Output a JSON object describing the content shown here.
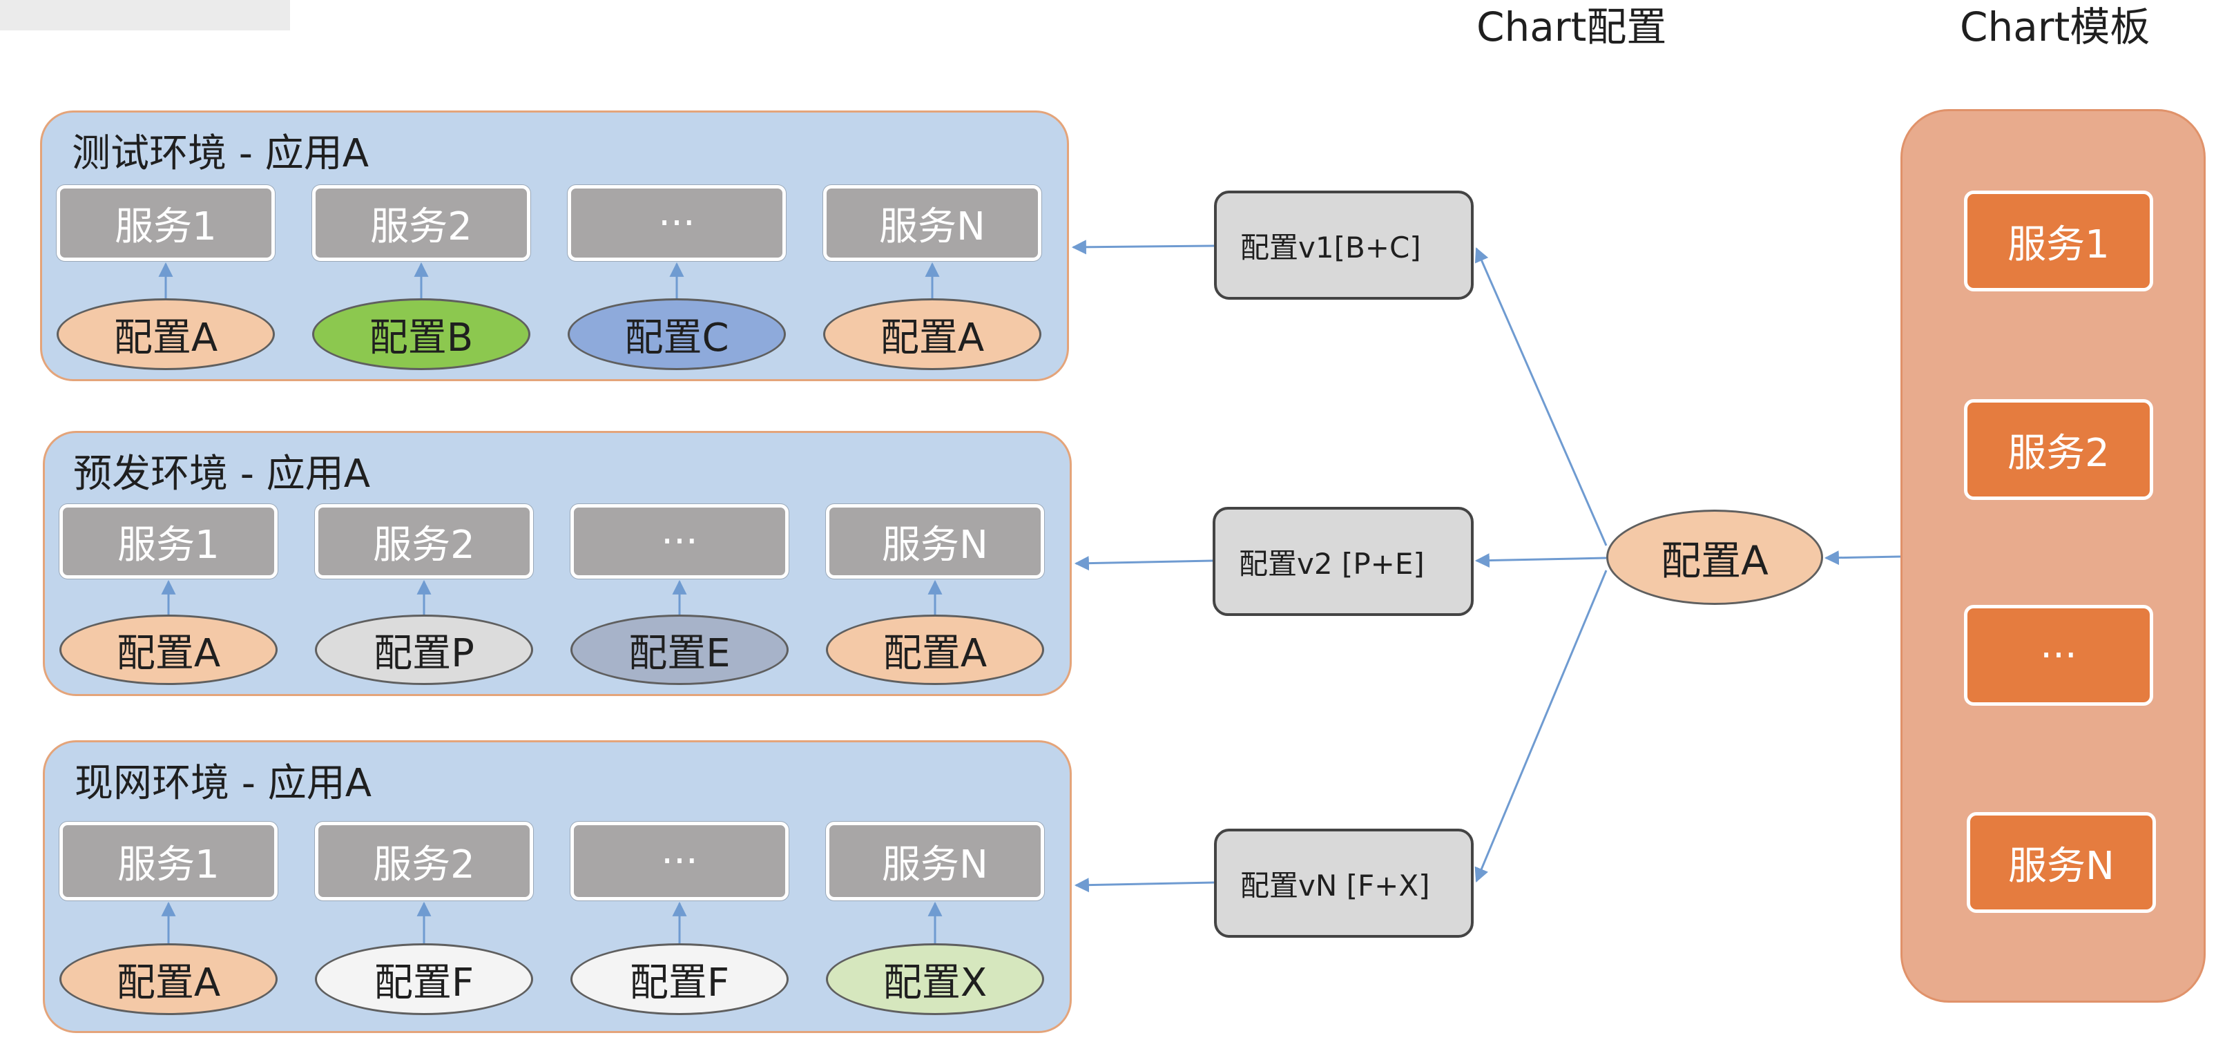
{
  "headers": {
    "chart_config": "Chart配置",
    "chart_template": "Chart模板"
  },
  "environments": [
    {
      "title": "测试环境 - 应用A",
      "services": [
        "服务1",
        "服务2",
        "···",
        "服务N"
      ],
      "configs": [
        {
          "label": "配置A",
          "color": "#f4c9a7"
        },
        {
          "label": "配置B",
          "color": "#8cc84f"
        },
        {
          "label": "配置C",
          "color": "#8eaadb"
        },
        {
          "label": "配置A",
          "color": "#f4c9a7"
        }
      ]
    },
    {
      "title": "预发环境 - 应用A",
      "services": [
        "服务1",
        "服务2",
        "···",
        "服务N"
      ],
      "configs": [
        {
          "label": "配置A",
          "color": "#f4c9a7"
        },
        {
          "label": "配置P",
          "color": "#dcdcdc"
        },
        {
          "label": "配置E",
          "color": "#a7b3c9"
        },
        {
          "label": "配置A",
          "color": "#f4c9a7"
        }
      ]
    },
    {
      "title": "现网环境 - 应用A",
      "services": [
        "服务1",
        "服务2",
        "···",
        "服务N"
      ],
      "configs": [
        {
          "label": "配置A",
          "color": "#f4c9a7"
        },
        {
          "label": "配置F",
          "color": "#f4f4f4"
        },
        {
          "label": "配置F",
          "color": "#f4f4f4"
        },
        {
          "label": "配置X",
          "color": "#d6e7be"
        }
      ]
    }
  ],
  "versions": [
    "配置v1[B+C]",
    "配置v2 [P+E]",
    "配置vN [F+X]"
  ],
  "source_config": "配置A",
  "template_services": [
    "服务1",
    "服务2",
    "···",
    "服务N"
  ],
  "colors": {
    "arrow": "#6f9bd1",
    "env_bg": "#c1d5ec",
    "template_bg": "#e8ab8d",
    "template_service": "#e57c3f"
  }
}
